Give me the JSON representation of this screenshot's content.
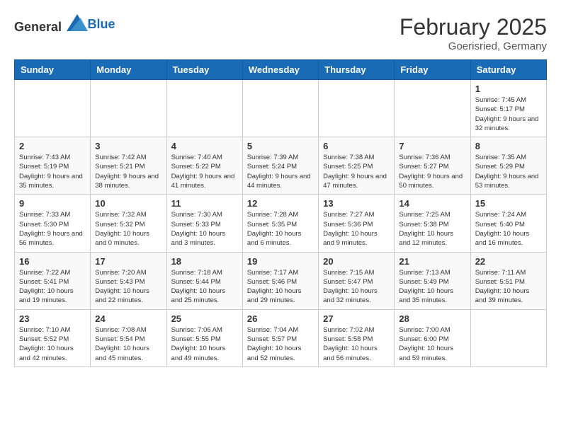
{
  "header": {
    "logo": {
      "general": "General",
      "blue": "Blue"
    },
    "title": "February 2025",
    "location": "Goerisried, Germany"
  },
  "calendar": {
    "weekdays": [
      "Sunday",
      "Monday",
      "Tuesday",
      "Wednesday",
      "Thursday",
      "Friday",
      "Saturday"
    ],
    "weeks": [
      [
        {
          "day": "",
          "info": ""
        },
        {
          "day": "",
          "info": ""
        },
        {
          "day": "",
          "info": ""
        },
        {
          "day": "",
          "info": ""
        },
        {
          "day": "",
          "info": ""
        },
        {
          "day": "",
          "info": ""
        },
        {
          "day": "1",
          "info": "Sunrise: 7:45 AM\nSunset: 5:17 PM\nDaylight: 9 hours and 32 minutes."
        }
      ],
      [
        {
          "day": "2",
          "info": "Sunrise: 7:43 AM\nSunset: 5:19 PM\nDaylight: 9 hours and 35 minutes."
        },
        {
          "day": "3",
          "info": "Sunrise: 7:42 AM\nSunset: 5:21 PM\nDaylight: 9 hours and 38 minutes."
        },
        {
          "day": "4",
          "info": "Sunrise: 7:40 AM\nSunset: 5:22 PM\nDaylight: 9 hours and 41 minutes."
        },
        {
          "day": "5",
          "info": "Sunrise: 7:39 AM\nSunset: 5:24 PM\nDaylight: 9 hours and 44 minutes."
        },
        {
          "day": "6",
          "info": "Sunrise: 7:38 AM\nSunset: 5:25 PM\nDaylight: 9 hours and 47 minutes."
        },
        {
          "day": "7",
          "info": "Sunrise: 7:36 AM\nSunset: 5:27 PM\nDaylight: 9 hours and 50 minutes."
        },
        {
          "day": "8",
          "info": "Sunrise: 7:35 AM\nSunset: 5:29 PM\nDaylight: 9 hours and 53 minutes."
        }
      ],
      [
        {
          "day": "9",
          "info": "Sunrise: 7:33 AM\nSunset: 5:30 PM\nDaylight: 9 hours and 56 minutes."
        },
        {
          "day": "10",
          "info": "Sunrise: 7:32 AM\nSunset: 5:32 PM\nDaylight: 10 hours and 0 minutes."
        },
        {
          "day": "11",
          "info": "Sunrise: 7:30 AM\nSunset: 5:33 PM\nDaylight: 10 hours and 3 minutes."
        },
        {
          "day": "12",
          "info": "Sunrise: 7:28 AM\nSunset: 5:35 PM\nDaylight: 10 hours and 6 minutes."
        },
        {
          "day": "13",
          "info": "Sunrise: 7:27 AM\nSunset: 5:36 PM\nDaylight: 10 hours and 9 minutes."
        },
        {
          "day": "14",
          "info": "Sunrise: 7:25 AM\nSunset: 5:38 PM\nDaylight: 10 hours and 12 minutes."
        },
        {
          "day": "15",
          "info": "Sunrise: 7:24 AM\nSunset: 5:40 PM\nDaylight: 10 hours and 16 minutes."
        }
      ],
      [
        {
          "day": "16",
          "info": "Sunrise: 7:22 AM\nSunset: 5:41 PM\nDaylight: 10 hours and 19 minutes."
        },
        {
          "day": "17",
          "info": "Sunrise: 7:20 AM\nSunset: 5:43 PM\nDaylight: 10 hours and 22 minutes."
        },
        {
          "day": "18",
          "info": "Sunrise: 7:18 AM\nSunset: 5:44 PM\nDaylight: 10 hours and 25 minutes."
        },
        {
          "day": "19",
          "info": "Sunrise: 7:17 AM\nSunset: 5:46 PM\nDaylight: 10 hours and 29 minutes."
        },
        {
          "day": "20",
          "info": "Sunrise: 7:15 AM\nSunset: 5:47 PM\nDaylight: 10 hours and 32 minutes."
        },
        {
          "day": "21",
          "info": "Sunrise: 7:13 AM\nSunset: 5:49 PM\nDaylight: 10 hours and 35 minutes."
        },
        {
          "day": "22",
          "info": "Sunrise: 7:11 AM\nSunset: 5:51 PM\nDaylight: 10 hours and 39 minutes."
        }
      ],
      [
        {
          "day": "23",
          "info": "Sunrise: 7:10 AM\nSunset: 5:52 PM\nDaylight: 10 hours and 42 minutes."
        },
        {
          "day": "24",
          "info": "Sunrise: 7:08 AM\nSunset: 5:54 PM\nDaylight: 10 hours and 45 minutes."
        },
        {
          "day": "25",
          "info": "Sunrise: 7:06 AM\nSunset: 5:55 PM\nDaylight: 10 hours and 49 minutes."
        },
        {
          "day": "26",
          "info": "Sunrise: 7:04 AM\nSunset: 5:57 PM\nDaylight: 10 hours and 52 minutes."
        },
        {
          "day": "27",
          "info": "Sunrise: 7:02 AM\nSunset: 5:58 PM\nDaylight: 10 hours and 56 minutes."
        },
        {
          "day": "28",
          "info": "Sunrise: 7:00 AM\nSunset: 6:00 PM\nDaylight: 10 hours and 59 minutes."
        },
        {
          "day": "",
          "info": ""
        }
      ]
    ]
  }
}
